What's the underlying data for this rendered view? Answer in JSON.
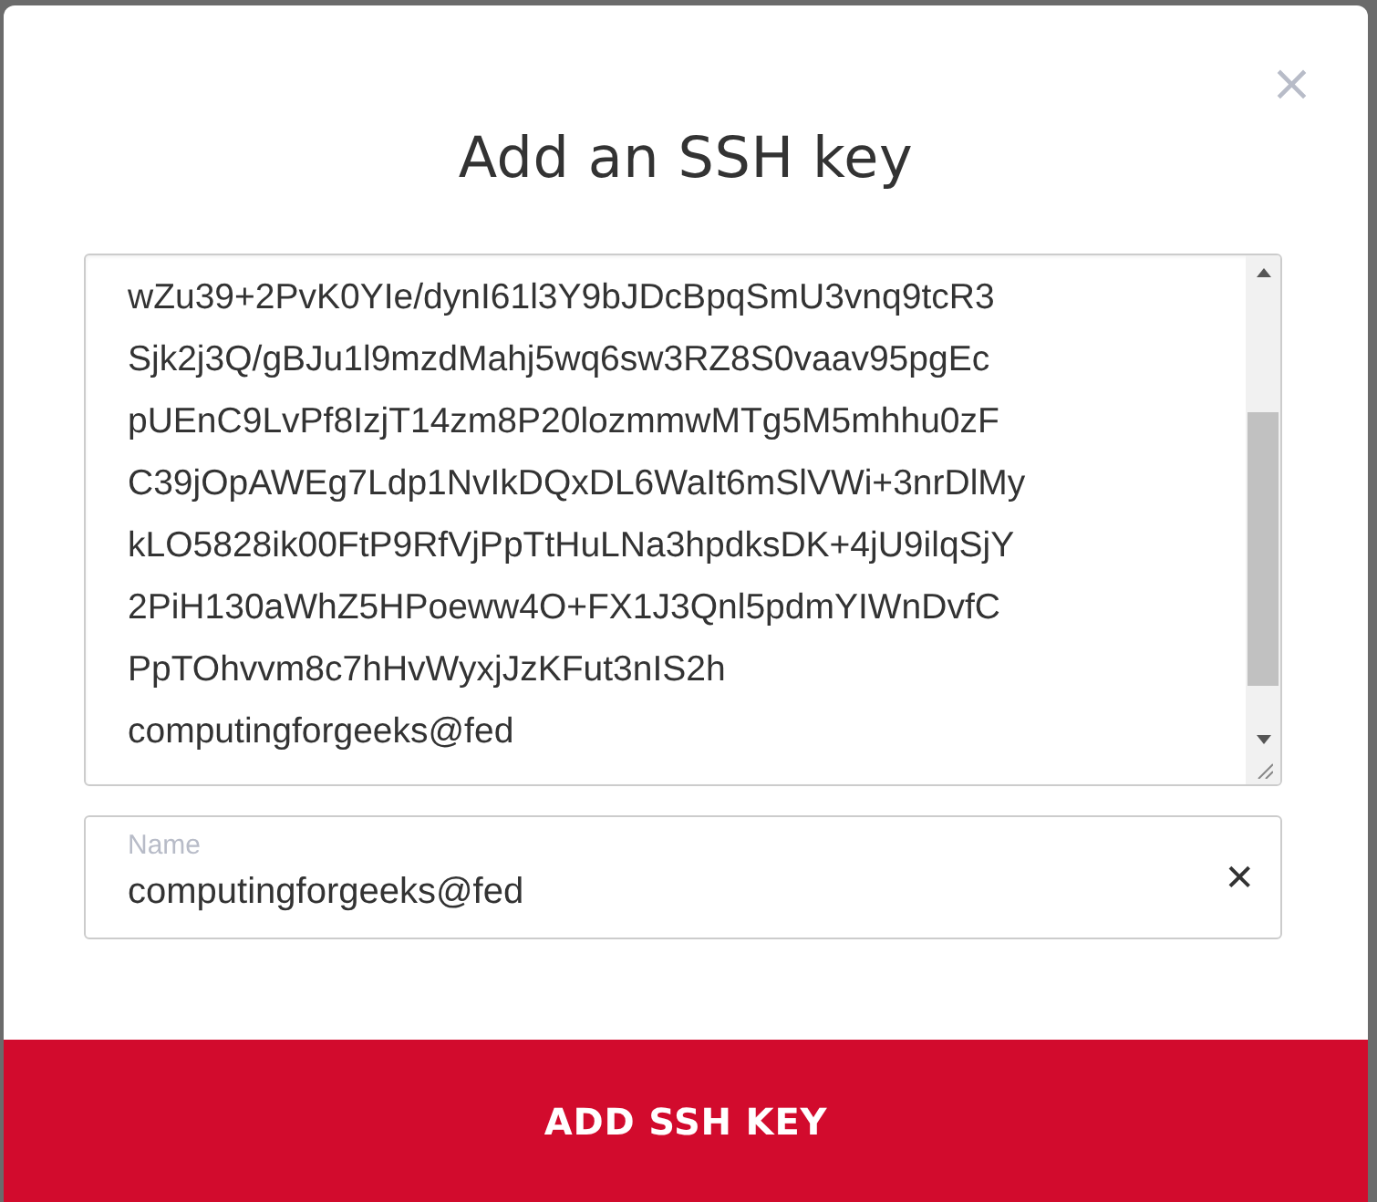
{
  "dialog": {
    "title": "Add an SSH key",
    "close": "×"
  },
  "key_field": {
    "lines": [
      "wZu39+2PvK0YIe/dynI61l3Y9bJDcBpqSmU3vnq9tcR3",
      "Sjk2j3Q/gBJu1l9mzdMahj5wq6sw3RZ8S0vaav95pgEc",
      "pUEnC9LvPf8IzjT14zm8P20lozmmwMTg5M5mhhu0zF",
      "C39jOpAWEg7Ldp1NvIkDQxDL6WaIt6mSlVWi+3nrDlMy",
      "kLO5828ik00FtP9RfVjPpTtHuLNa3hpdksDK+4jU9ilqSjY",
      "2PiH130aWhZ5HPoeww4O+FX1J3Qnl5pdmYIWnDvfC",
      "PpTOhvvm8c7hHvWyxjJzKFut3nIS2h",
      "computingforgeeks@fed"
    ]
  },
  "name_field": {
    "label": "Name",
    "value": "computingforgeeks@fed",
    "clear": "✕"
  },
  "submit_button": {
    "label": "ADD SSH KEY"
  }
}
